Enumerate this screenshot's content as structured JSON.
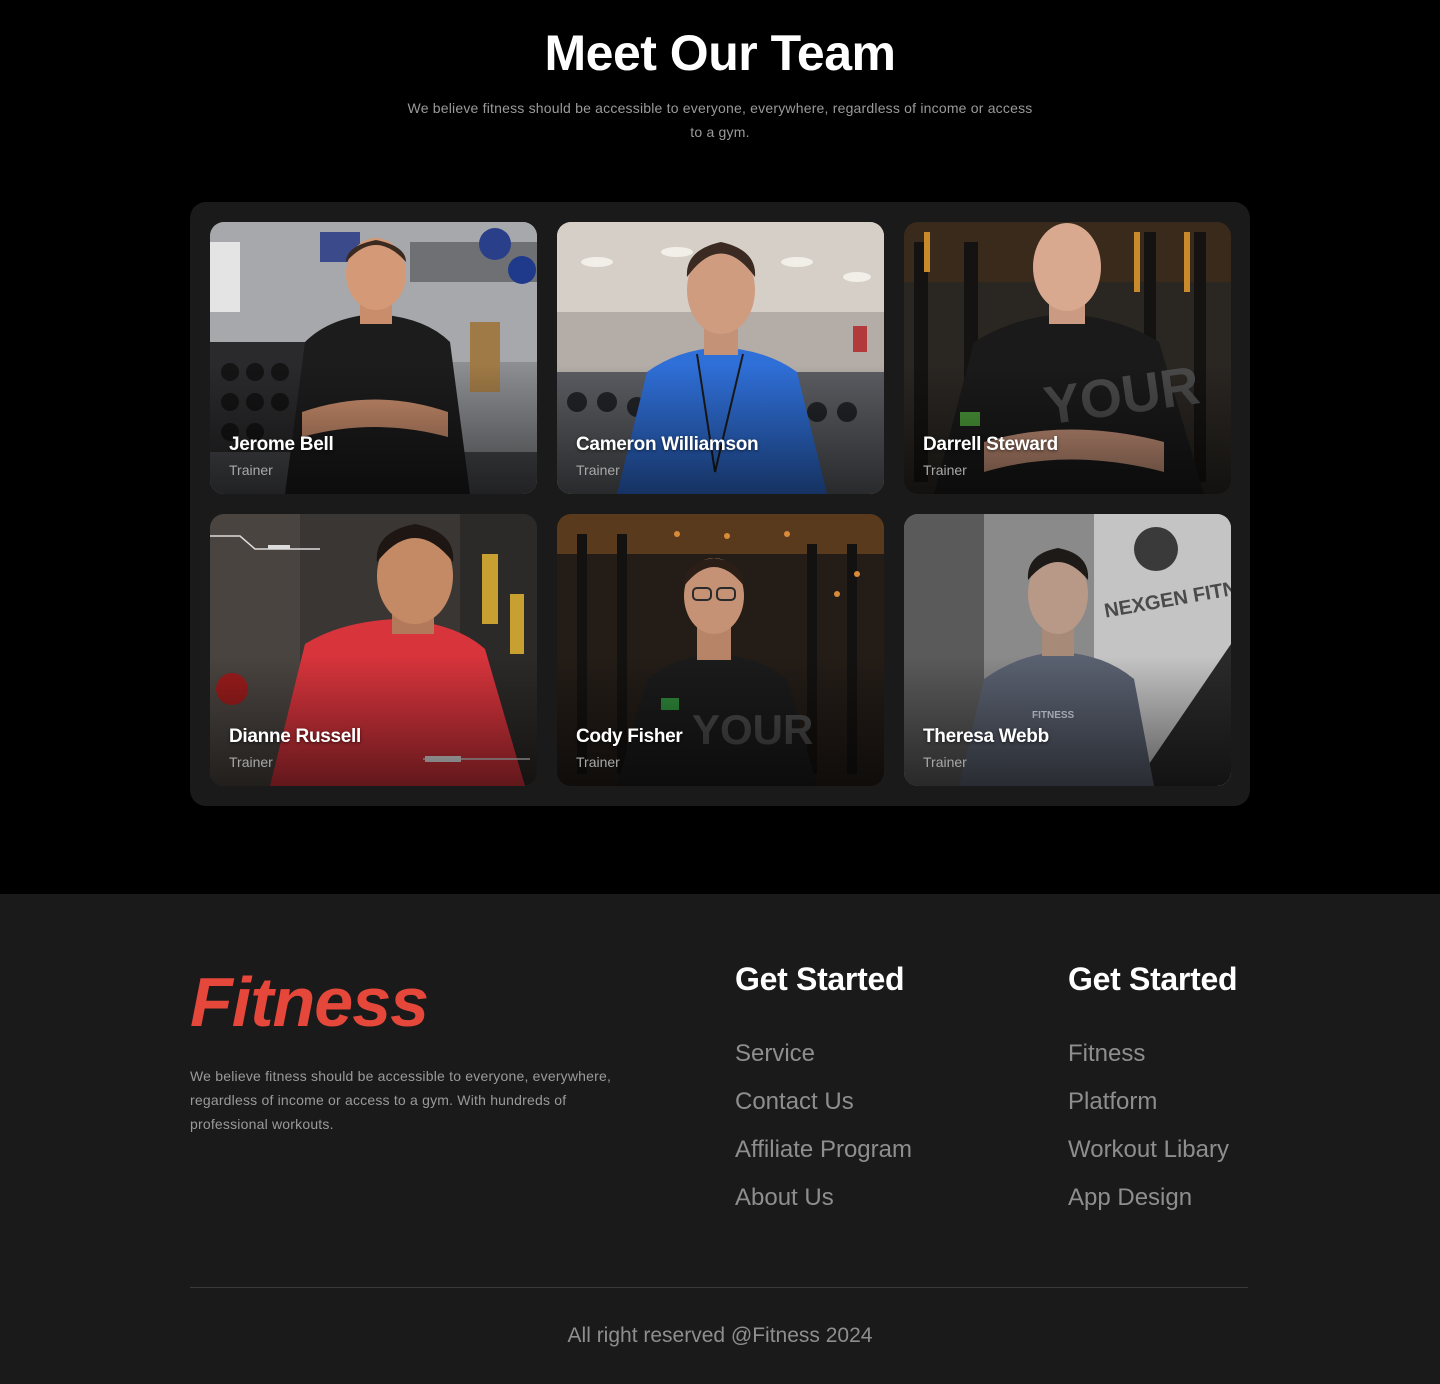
{
  "team": {
    "title": "Meet Our Team",
    "subtitle": "We believe fitness should be accessible to everyone, everywhere, regardless of income or access to a gym.",
    "members": [
      {
        "name": "Jerome Bell",
        "role": "Trainer",
        "shirt_color": "#1c1c1c"
      },
      {
        "name": "Cameron Williamson",
        "role": "Trainer",
        "shirt_color": "#2f6fd8"
      },
      {
        "name": "Darrell Steward",
        "role": "Trainer",
        "shirt_color": "#1a1a1a"
      },
      {
        "name": "Dianne Russell",
        "role": "Trainer",
        "shirt_color": "#d8343c"
      },
      {
        "name": "Cody Fisher",
        "role": "Trainer",
        "shirt_color": "#1b1b1b"
      },
      {
        "name": "Theresa Webb",
        "role": "Trainer",
        "shirt_color": "#5a6170"
      }
    ]
  },
  "footer": {
    "logo": "Fitness",
    "about": "We believe fitness should be accessible to everyone, everywhere, regardless of income or access to a gym. With hundreds of professional workouts.",
    "columns": [
      {
        "heading": "Get Started",
        "links": [
          "Service",
          "Contact Us",
          "Affiliate Program",
          "About Us"
        ]
      },
      {
        "heading": "Get Started",
        "links": [
          "Fitness",
          "Platform",
          "Workout Libary",
          "App Design"
        ]
      }
    ],
    "copyright": "All right reserved @Fitness 2024"
  },
  "colors": {
    "brand": "#e5473a",
    "background": "#000000",
    "panel": "#1a1a1a"
  }
}
